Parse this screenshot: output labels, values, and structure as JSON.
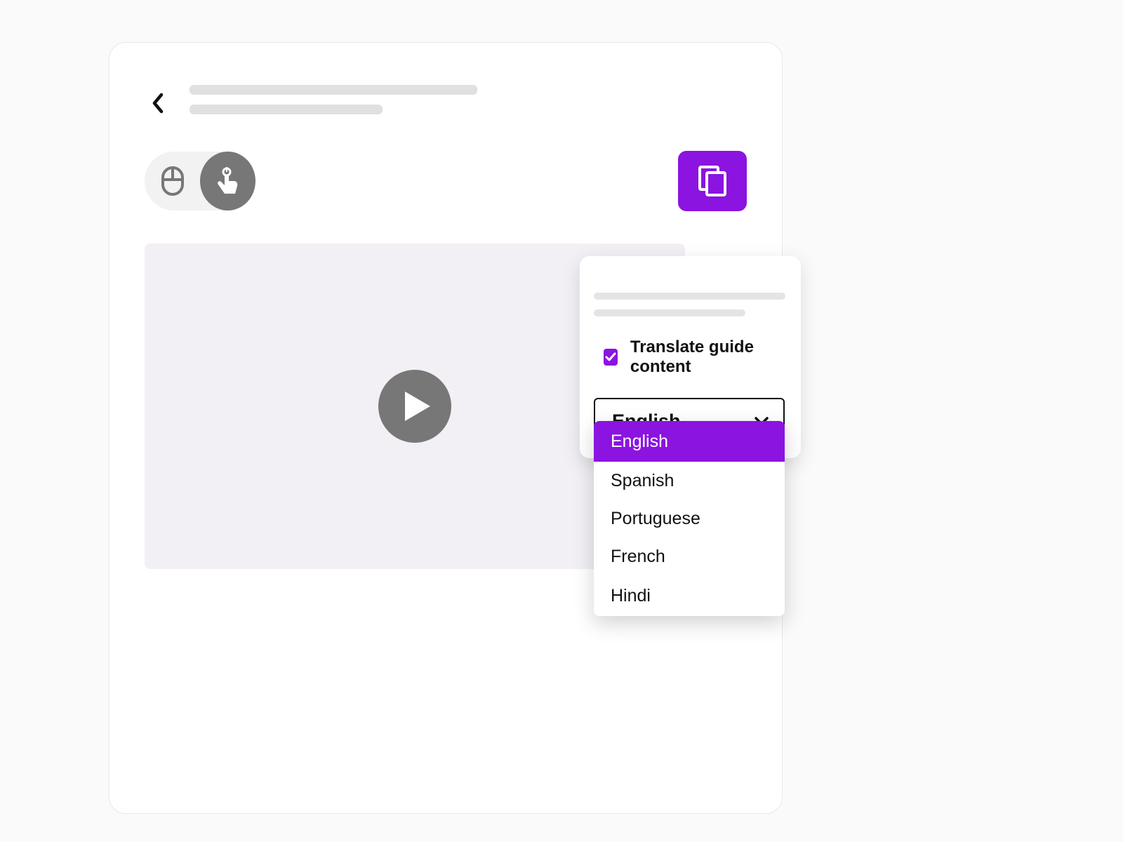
{
  "colors": {
    "accent": "#8b14e0",
    "toggle_active": "#777777"
  },
  "toolbar": {
    "mode_options": [
      "mouse",
      "touch"
    ],
    "mode_active": "touch"
  },
  "popover": {
    "translate_label": "Translate guide content",
    "translate_checked": true,
    "select": {
      "value": "English",
      "options": [
        "English",
        "Spanish",
        "Portuguese",
        "French",
        "Hindi"
      ],
      "expanded": true
    }
  }
}
